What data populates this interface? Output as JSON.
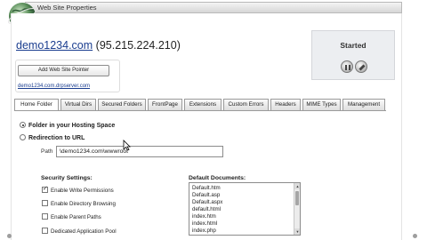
{
  "window": {
    "title": "Web Site Properties"
  },
  "site": {
    "domain": "demo1234.com",
    "ip": "(95.215.224.210)"
  },
  "hosting": {
    "add_pointer_label": "Add Web Site Pointer",
    "preview_url": "demo1234.com.drpserver.com"
  },
  "status": {
    "text": "Started",
    "buttons": [
      "pause-icon",
      "stop-icon"
    ]
  },
  "tabs": [
    {
      "label": "Home Folder",
      "active": true
    },
    {
      "label": "Virtual Dirs"
    },
    {
      "label": "Secured Folders"
    },
    {
      "label": "FrontPage"
    },
    {
      "label": "Extensions"
    },
    {
      "label": "Custom Errors"
    },
    {
      "label": "Headers"
    },
    {
      "label": "MIME Types"
    },
    {
      "label": "Management"
    }
  ],
  "home_folder": {
    "folder_option": "Folder in your Hosting Space",
    "redirect_option": "Redirection to URL",
    "path_label": "Path",
    "path_value": "\\demo1234.com\\wwwroot"
  },
  "security": {
    "title": "Security Settings:",
    "options": [
      {
        "label": "Enable Write Permissions",
        "checked": true
      },
      {
        "label": "Enable Directory Browsing",
        "checked": false
      },
      {
        "label": "Enable Parent Paths",
        "checked": false
      },
      {
        "label": "Dedicated Application Pool",
        "checked": false
      }
    ]
  },
  "default_docs": {
    "title": "Default Documents:",
    "items": [
      "Default.htm",
      "Default.asp",
      "Default.aspx",
      "default.html",
      "index.htm",
      "index.html",
      "index.php"
    ]
  }
}
